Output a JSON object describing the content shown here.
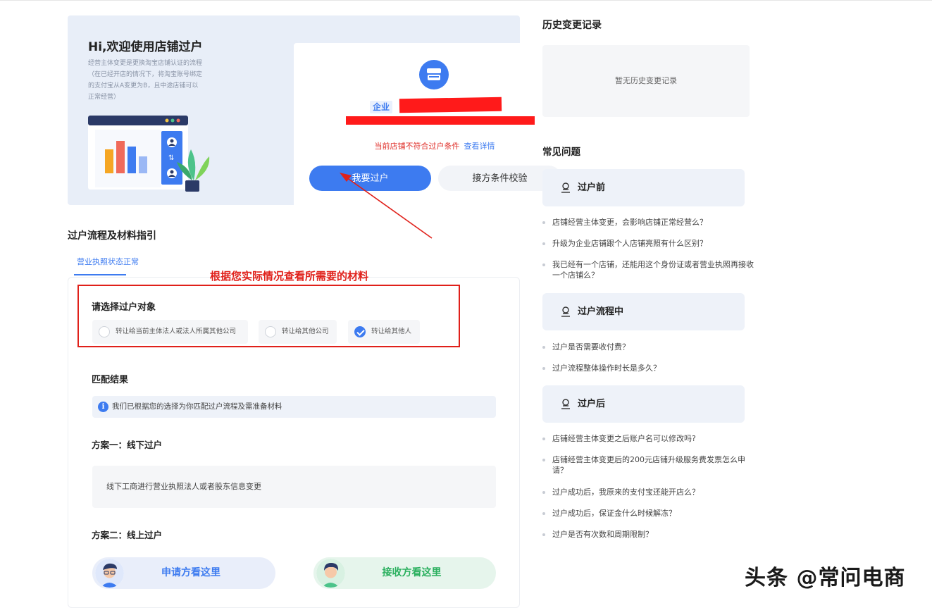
{
  "hero": {
    "title": "Hi,欢迎使用店铺过户",
    "desc": "经营主体变更是更换淘宝店铺认证的流程（在已经开店的情况下，将淘宝账号绑定的支付宝从A变更为B，且中途店铺可以正常经营）"
  },
  "card": {
    "type_tag": "企业",
    "status_warning": "当前店铺不符合过户条件",
    "status_link": "查看详情",
    "transfer_button": "我要过户",
    "check_button": "接方条件校验"
  },
  "flow": {
    "section_title": "过户流程及材料指引",
    "active_tab": "营业执照状态正常",
    "annotation": "根据您实际情况查看所需要的材料",
    "choose_title": "请选择过户对象",
    "options": [
      {
        "label": "转让给当前主体法人或法人所属其他公司",
        "checked": false
      },
      {
        "label": "转让给其他公司",
        "checked": false
      },
      {
        "label": "转让给其他人",
        "checked": true
      }
    ],
    "match_title": "匹配结果",
    "match_info": "我们已根据您的选择为你匹配过户流程及需准备材料",
    "plan1_title": "方案一：线下过户",
    "plan1_desc": "线下工商进行营业执照法人或者股东信息变更",
    "plan2_title": "方案二：线上过户",
    "apply_label": "申请方看这里",
    "receive_label": "接收方看这里"
  },
  "history": {
    "title": "历史变更记录",
    "empty": "暂无历史变更记录"
  },
  "faq": {
    "title": "常见问题",
    "before": {
      "heading": "过户前",
      "questions": [
        "店铺经营主体变更，会影响店铺正常经营么？",
        "升级为企业店铺跟个人店铺亮照有什么区别？",
        "我已经有一个店铺，还能用这个身份证或者营业执照再接收一个店铺么？"
      ]
    },
    "during": {
      "heading": "过户流程中",
      "questions": [
        "过户是否需要收付费？",
        "过户流程整体操作时长是多久？"
      ]
    },
    "after": {
      "heading": "过户后",
      "questions": [
        "店铺经营主体变更之后账户名可以修改吗?",
        "店铺经营主体变更后的200元店铺升级服务费发票怎么申请？",
        "过户成功后，我原来的支付宝还能开店么？",
        "过户成功后，保证金什么时候解冻？",
        "过户是否有次数和周期限制？"
      ]
    }
  },
  "watermark": "头条 @常问电商",
  "colors": {
    "primary": "#3d7bf0",
    "warning": "#e0332d",
    "annotation": "#e0201a",
    "green": "#2bb05f"
  }
}
